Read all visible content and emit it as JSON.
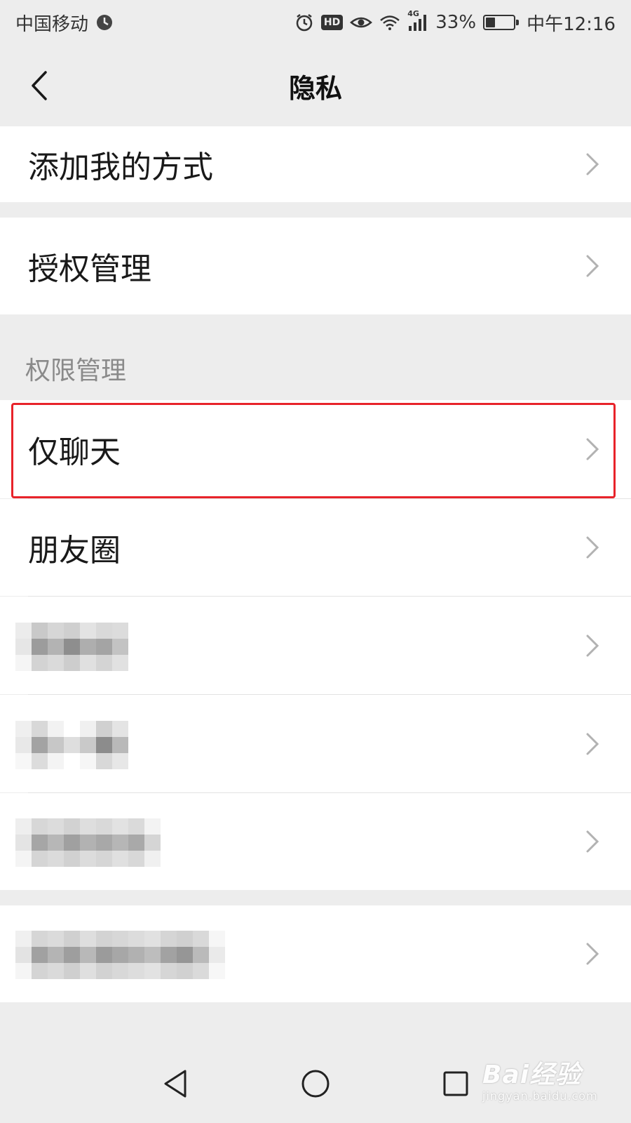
{
  "status_bar": {
    "carrier": "中国移动",
    "network": "4G",
    "battery": "33%",
    "battery_level": 0.33,
    "time": "中午12:16",
    "hd_badge": "HD"
  },
  "nav": {
    "title": "隐私"
  },
  "cells": {
    "add_me": "添加我的方式",
    "authorization": "授权管理",
    "chat_only": "仅聊天",
    "moments": "朋友圈"
  },
  "sections": {
    "permissions_header": "权限管理"
  },
  "watermark": {
    "logo": "Bai经验",
    "site": "jingyan.baidu.com"
  },
  "colors": {
    "background": "#ededed",
    "cell_background": "#ffffff",
    "highlight_border": "#e8232a",
    "section_header_text": "#8a8a8a"
  },
  "icons": [
    "clock-icon",
    "alarm-icon",
    "eye-icon",
    "wifi-icon",
    "signal-icon",
    "battery-icon",
    "back-arrow-icon",
    "chevron-right-icon",
    "triangle-back-icon",
    "circle-home-icon",
    "square-recents-icon"
  ]
}
